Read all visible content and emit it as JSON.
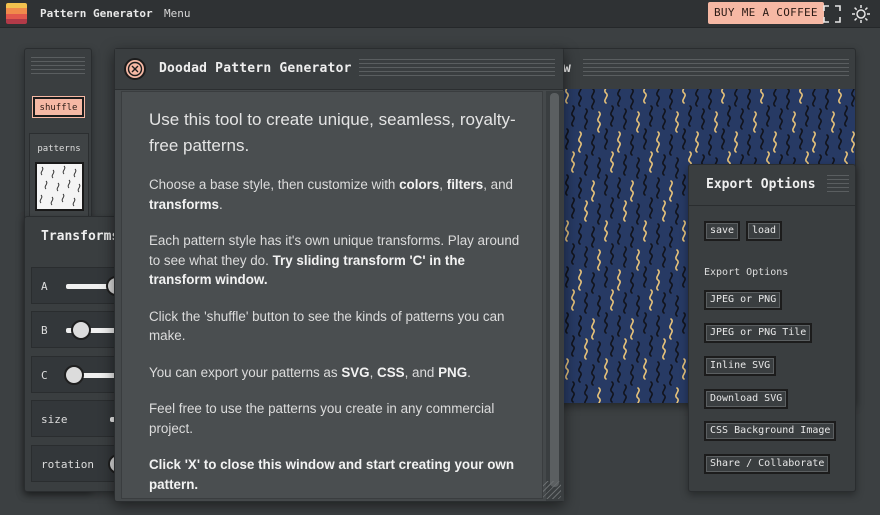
{
  "app": {
    "title": "Pattern Generator",
    "menu_label": "Menu",
    "coffee_label": "BUY ME A COFFEE",
    "logo_colors": [
      "#f2c14e",
      "#f08a4b",
      "#e2574c",
      "#b23a48"
    ]
  },
  "sidebar": {
    "shuffle_label": "shuffle",
    "patterns_label": "patterns"
  },
  "transforms": {
    "title": "Transforms",
    "sliders": [
      {
        "label": "A",
        "value": 0.6
      },
      {
        "label": "B",
        "value": 0.1
      },
      {
        "label": "C",
        "value": 0.0
      },
      {
        "label": "size",
        "value": 0.35
      },
      {
        "label": "rotation",
        "value": 0.0
      }
    ]
  },
  "preview": {
    "title_fragment": "w",
    "background": "#273a64",
    "accent_squiggle": "#e6c27a",
    "dark_squiggle": "#12141c"
  },
  "export": {
    "title": "Export Options",
    "save_label": "save",
    "load_label": "load",
    "section_label": "Export Options",
    "buttons": [
      "JPEG or PNG",
      "JPEG or PNG Tile",
      "Inline SVG",
      "Download SVG",
      "CSS Background Image",
      "Share / Collaborate"
    ]
  },
  "modal": {
    "title": "Doodad Pattern Generator",
    "lead": "Use this tool to create unique, seamless, royalty-free patterns.",
    "p1_a": "Choose a base style, then customize with ",
    "p1_b": "colors",
    "p1_c": ", ",
    "p1_d": "filters",
    "p1_e": ", and ",
    "p1_f": "transforms",
    "p1_g": ".",
    "p2_a": "Each pattern style has it's own unique transforms. Play around to see what they do. ",
    "p2_b": "Try sliding transform 'C' in the transform window.",
    "p3": "Click the 'shuffle' button to see the kinds of patterns you can make.",
    "p4_a": "You can export your patterns as ",
    "p4_b": "SVG",
    "p4_c": ", ",
    "p4_d": "CSS",
    "p4_e": ", and ",
    "p4_f": "PNG",
    "p4_g": ".",
    "p5": "Feel free to use the patterns you create in any commercial project.",
    "p6": "Click 'X' to close this window and start creating your own pattern."
  }
}
